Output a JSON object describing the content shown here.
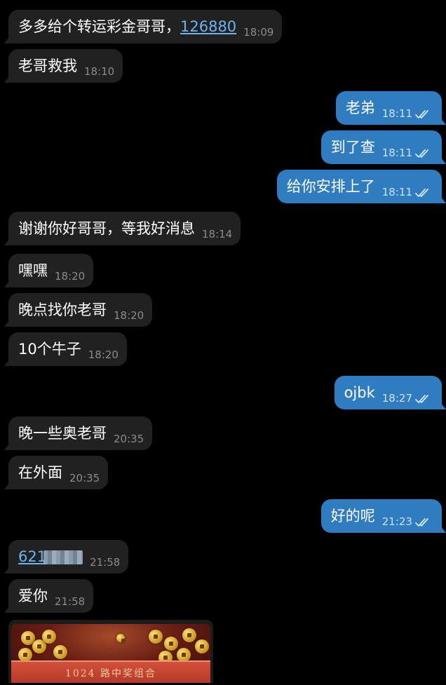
{
  "messages": [
    {
      "dir": "in",
      "parts": [
        {
          "t": "多多给个转运彩金哥哥，"
        },
        {
          "t": "126880",
          "link": true
        }
      ],
      "time": "18:09"
    },
    {
      "dir": "in",
      "parts": [
        {
          "t": "老哥救我"
        }
      ],
      "time": "18:10"
    },
    {
      "dir": "out",
      "parts": [
        {
          "t": "老弟"
        }
      ],
      "time": "18:11"
    },
    {
      "dir": "out",
      "parts": [
        {
          "t": "到了查"
        }
      ],
      "time": "18:11"
    },
    {
      "dir": "out",
      "parts": [
        {
          "t": "给你安排上了"
        }
      ],
      "time": "18:11"
    },
    {
      "dir": "in",
      "parts": [
        {
          "t": "谢谢你好哥哥，等我好消息"
        }
      ],
      "time": "18:14"
    },
    {
      "dir": "in",
      "parts": [
        {
          "t": "嘿嘿"
        }
      ],
      "time": "18:20"
    },
    {
      "dir": "in",
      "parts": [
        {
          "t": "晚点找你老哥"
        }
      ],
      "time": "18:20"
    },
    {
      "dir": "in",
      "parts": [
        {
          "t": "10个牛子"
        }
      ],
      "time": "18:20"
    },
    {
      "dir": "out",
      "parts": [
        {
          "t": "ojbk"
        }
      ],
      "time": "18:27"
    },
    {
      "dir": "in",
      "parts": [
        {
          "t": "晚一些奥老哥"
        }
      ],
      "time": "20:35"
    },
    {
      "dir": "in",
      "parts": [
        {
          "t": "在外面"
        }
      ],
      "time": "20:35"
    },
    {
      "dir": "out",
      "parts": [
        {
          "t": "好的呢"
        }
      ],
      "time": "21:23"
    },
    {
      "dir": "in",
      "parts": [
        {
          "t": "621",
          "link": true,
          "redacted": true
        }
      ],
      "time": "21:58"
    },
    {
      "dir": "in",
      "parts": [
        {
          "t": "爱你"
        }
      ],
      "time": "21:58"
    }
  ],
  "image_message": {
    "caption": "1024 路中奖组合"
  },
  "colors": {
    "background": "#000000",
    "incoming_bubble": "#212121",
    "outgoing_bubble": "#2f7dc0",
    "link": "#6cb4f0"
  },
  "icons": {
    "read_receipt": "double-check-icon"
  }
}
